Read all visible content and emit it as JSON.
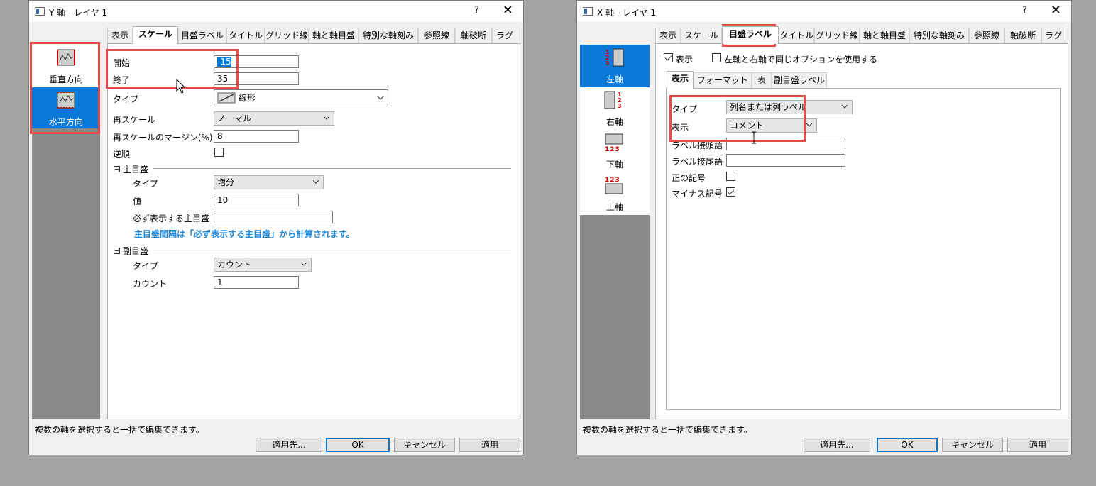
{
  "yDialog": {
    "title": "Y 軸 - レイヤ 1",
    "help": "?",
    "close": "✕",
    "sidebar": [
      {
        "label": "垂直方向",
        "icon": "vertical-axis-icon",
        "selected": false
      },
      {
        "label": "水平方向",
        "icon": "horizontal-axis-icon",
        "selected": true
      }
    ],
    "tabs": [
      "表示",
      "スケール",
      "目盛ラベル",
      "タイトル",
      "グリッド線",
      "軸と軸目盛",
      "特別な軸刻み",
      "参照線",
      "軸破断",
      "ラグ"
    ],
    "activeTab": "スケール",
    "scale": {
      "start_label": "開始",
      "start_value": "-15",
      "end_label": "終了",
      "end_value": "35",
      "type_label": "タイプ",
      "type_value": "線形",
      "rescale_label": "再スケール",
      "rescale_value": "ノーマル",
      "margin_label": "再スケールのマージン(%)",
      "margin_value": "8",
      "reverse_label": "逆順",
      "reverse_checked": false
    },
    "major": {
      "header": "主目盛",
      "type_label": "タイプ",
      "type_value": "増分",
      "value_label": "値",
      "value_value": "10",
      "must_label": "必ず表示する主目盛",
      "must_value": "",
      "note": "主目盛間隔は「必ず表示する主目盛」から計算されます。"
    },
    "minor": {
      "header": "副目盛",
      "type_label": "タイプ",
      "type_value": "カウント",
      "count_label": "カウント",
      "count_value": "1"
    },
    "status": "複数の軸を選択すると一括で編集できます。",
    "buttons": {
      "apply_to": "適用先...",
      "ok": "OK",
      "cancel": "キャンセル",
      "apply": "適用"
    }
  },
  "xDialog": {
    "title": "X 軸 - レイヤ 1",
    "help": "?",
    "close": "✕",
    "sidebar": [
      {
        "label": "左軸",
        "icon": "left-axis-icon",
        "selected": true
      },
      {
        "label": "右軸",
        "icon": "right-axis-icon",
        "selected": false
      },
      {
        "label": "下軸",
        "icon": "bottom-axis-icon",
        "selected": false
      },
      {
        "label": "上軸",
        "icon": "top-axis-icon",
        "selected": false
      }
    ],
    "tabs": [
      "表示",
      "スケール",
      "目盛ラベル",
      "タイトル",
      "グリッド線",
      "軸と軸目盛",
      "特別な軸刻み",
      "参照線",
      "軸破断",
      "ラグ"
    ],
    "activeTab": "目盛ラベル",
    "show_label": "表示",
    "show_checked": true,
    "same_label": "左軸と右軸で同じオプションを使用する",
    "same_checked": false,
    "subtabs": [
      "表示",
      "フォーマット",
      "表",
      "副目盛ラベル"
    ],
    "activeSubtab": "表示",
    "fields": {
      "type_label": "タイプ",
      "type_value": "列名または列ラベル",
      "display_label": "表示",
      "display_value": "コメント",
      "prefix_label": "ラベル接頭語",
      "prefix_value": "",
      "suffix_label": "ラベル接尾語",
      "suffix_value": "",
      "plus_label": "正の記号",
      "plus_checked": false,
      "minus_label": "マイナス記号",
      "minus_checked": true
    },
    "status": "複数の軸を選択すると一括で編集できます。",
    "buttons": {
      "apply_to": "適用先...",
      "ok": "OK",
      "cancel": "キャンセル",
      "apply": "適用"
    }
  },
  "colors": {
    "accent": "#0a78d7",
    "highlight": "#e84a4a",
    "note": "#1c86d8"
  }
}
